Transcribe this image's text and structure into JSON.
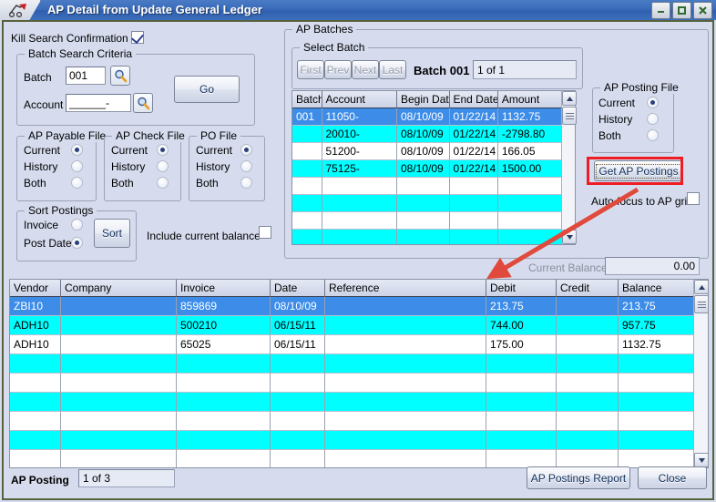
{
  "window": {
    "title": "AP Detail from Update General Ledger",
    "app_icon": "app-icon",
    "minimize_label": "–",
    "maximize_label": "□",
    "close_label": "✕"
  },
  "left": {
    "kill_search_label": "Kill Search Confirmation",
    "kill_search_checked": true,
    "batch_search": {
      "legend": "Batch Search Criteria",
      "batch_label": "Batch",
      "batch_value": "001",
      "account_label": "Account",
      "account_value": "______-",
      "go_label": "Go",
      "lookup_icon": "magnifier-icon"
    },
    "ap_payable_file": {
      "legend": "AP Payable File",
      "options": [
        "Current",
        "History",
        "Both"
      ],
      "selected": "Current"
    },
    "ap_check_file": {
      "legend": "AP Check File",
      "options": [
        "Current",
        "History",
        "Both"
      ],
      "selected": "Current"
    },
    "po_file": {
      "legend": "PO File",
      "options": [
        "Current",
        "History",
        "Both"
      ],
      "selected": "Current"
    },
    "sort_postings": {
      "legend": "Sort Postings",
      "options": [
        "Invoice",
        "Post Date"
      ],
      "selected": "Post Date",
      "sort_label": "Sort"
    },
    "include_balance_label": "Include current balance",
    "include_balance_checked": false
  },
  "ap_batches": {
    "legend": "AP Batches",
    "select_batch": {
      "legend": "Select Batch",
      "first_label": "First",
      "prev_label": "Prev",
      "next_label": "Next",
      "last_label": "Last",
      "batch_title": "Batch 001",
      "position": "1 of 1"
    },
    "grid": {
      "columns": [
        "Batch",
        "Account",
        "Begin Date",
        "End Date",
        "Amount"
      ],
      "rows": [
        {
          "cells": [
            "001",
            "11050-",
            "08/10/09",
            "01/22/14",
            "1132.75"
          ],
          "style": "selected"
        },
        {
          "cells": [
            "",
            "20010-",
            "08/10/09",
            "01/22/14",
            "-2798.80"
          ],
          "style": "cyan"
        },
        {
          "cells": [
            "",
            "51200-",
            "08/10/09",
            "01/22/14",
            "166.05"
          ],
          "style": "white"
        },
        {
          "cells": [
            "",
            "75125-",
            "08/10/09",
            "01/22/14",
            "1500.00"
          ],
          "style": "cyan"
        },
        {
          "cells": [
            "",
            "",
            "",
            "",
            ""
          ],
          "style": "white"
        },
        {
          "cells": [
            "",
            "",
            "",
            "",
            ""
          ],
          "style": "cyan"
        },
        {
          "cells": [
            "",
            "",
            "",
            "",
            ""
          ],
          "style": "white"
        },
        {
          "cells": [
            "",
            "",
            "",
            "",
            ""
          ],
          "style": "cyan"
        }
      ]
    },
    "ap_posting_file": {
      "legend": "AP Posting File",
      "options": [
        "Current",
        "History",
        "Both"
      ],
      "selected": "Current"
    },
    "get_postings_label": "Get AP Postings",
    "auto_focus_label": "Auto focus to AP grid",
    "auto_focus_checked": false,
    "current_balance_label": "Current Balance",
    "current_balance_value": "0.00"
  },
  "ap_grid": {
    "columns": [
      "Vendor",
      "Company",
      "Invoice",
      "Date",
      "Reference",
      "Debit",
      "Credit",
      "Balance"
    ],
    "rows": [
      {
        "cells": [
          "ZBI10",
          "",
          "859869",
          "08/10/09",
          "",
          "213.75",
          "",
          "213.75"
        ],
        "style": "selected"
      },
      {
        "cells": [
          "ADH10",
          "",
          "500210",
          "06/15/11",
          "",
          "744.00",
          "",
          "957.75"
        ],
        "style": "cyan"
      },
      {
        "cells": [
          "ADH10",
          "",
          "65025",
          "06/15/11",
          "",
          "175.00",
          "",
          "1132.75"
        ],
        "style": "white"
      },
      {
        "cells": [
          "",
          "",
          "",
          "",
          "",
          "",
          "",
          ""
        ],
        "style": "cyan"
      },
      {
        "cells": [
          "",
          "",
          "",
          "",
          "",
          "",
          "",
          ""
        ],
        "style": "white"
      },
      {
        "cells": [
          "",
          "",
          "",
          "",
          "",
          "",
          "",
          ""
        ],
        "style": "cyan"
      },
      {
        "cells": [
          "",
          "",
          "",
          "",
          "",
          "",
          "",
          ""
        ],
        "style": "white"
      },
      {
        "cells": [
          "",
          "",
          "",
          "",
          "",
          "",
          "",
          ""
        ],
        "style": "cyan"
      },
      {
        "cells": [
          "",
          "",
          "",
          "",
          "",
          "",
          "",
          ""
        ],
        "style": "white"
      }
    ]
  },
  "footer": {
    "ap_posting_label": "AP Posting",
    "ap_posting_position": "1 of 3",
    "report_label": "AP Postings Report",
    "close_label": "Close"
  },
  "annotation": {
    "highlight_target": "get-ap-postings-button",
    "arrow_color": "#e04a3c",
    "highlight_color": "#ee1c24"
  }
}
